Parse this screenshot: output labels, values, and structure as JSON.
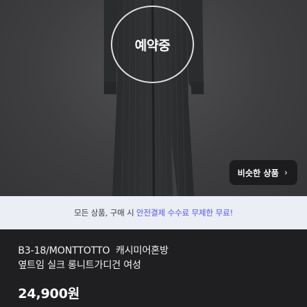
{
  "photo": {
    "status_badge": "예약중",
    "similar_button": {
      "label": "비슷한 상품",
      "chevron": "›",
      "icon": "chevron-right-icon"
    }
  },
  "banner": {
    "text_before": "모든 상품, 구매 시 ",
    "text_highlight": "안전결제 수수료 무제한 무료!",
    "highlight_color": "#4f57e6"
  },
  "product": {
    "title_line1": "B3-18/MONTTOTTO  캐시미어혼방",
    "title_line2": "옆트임 실크 롱니트가디건 여성",
    "price": "24,900원"
  }
}
